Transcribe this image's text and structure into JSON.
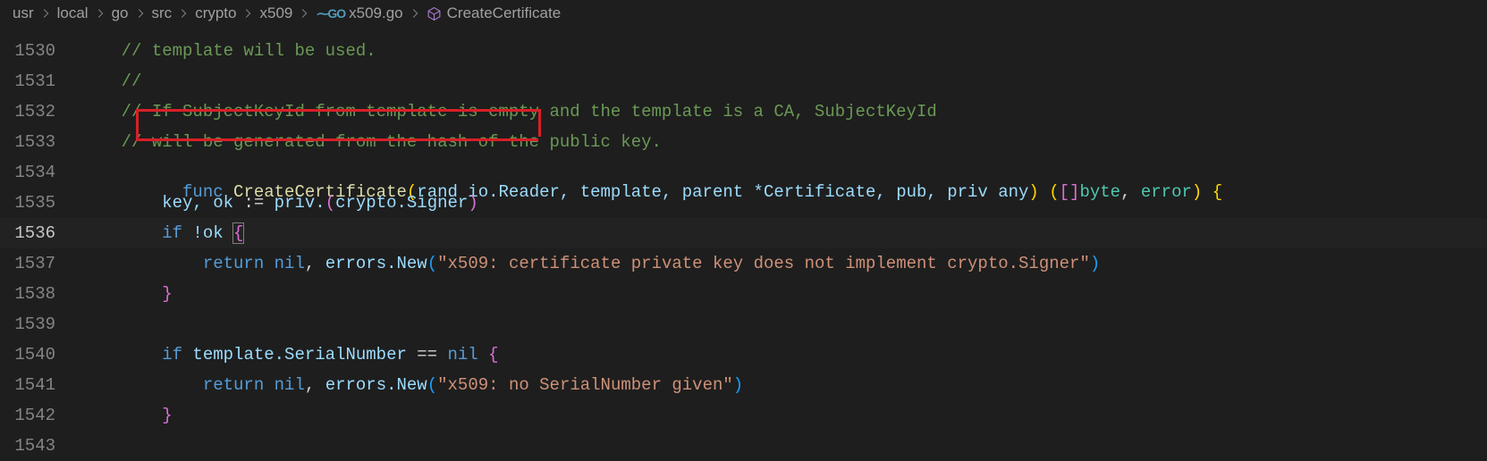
{
  "breadcrumb": {
    "items": [
      "usr",
      "local",
      "go",
      "src",
      "crypto",
      "x509"
    ],
    "file": "x509.go",
    "symbol": "CreateCertificate"
  },
  "lines": {
    "start": 1530,
    "current": 1536,
    "1530": "// template will be used.",
    "1531": "//",
    "1532": "// If SubjectKeyId from template is empty and the template is a CA, SubjectKeyId",
    "1533": "// will be generated from the hash of the public key.",
    "1534": {
      "func": "func",
      "name": "CreateCertificate",
      "params_head": "rand io.Reader,",
      "params_tail": " template, parent *Certificate, pub, priv any",
      "ret": "[]byte, error"
    },
    "1535": {
      "lhs": "key, ok",
      "op": ":=",
      "rhs_a": "priv.",
      "rhs_type": "crypto.Signer"
    },
    "1536": {
      "if": "if",
      "cond": " !ok "
    },
    "1537": {
      "ret": "return",
      "nil": "nil",
      "call": "errors.New",
      "str": "\"x509: certificate private key does not implement crypto.Signer\""
    },
    "1538": "",
    "1539": "",
    "1540": {
      "if": "if",
      "cond_a": " template.SerialNumber ",
      "op": "==",
      "cond_b": " ",
      "nil": "nil",
      "sp": " "
    },
    "1541": {
      "ret": "return",
      "nil": "nil",
      "call": "errors.New",
      "str": "\"x509: no SerialNumber given\""
    },
    "1542": "",
    "1543": ""
  }
}
